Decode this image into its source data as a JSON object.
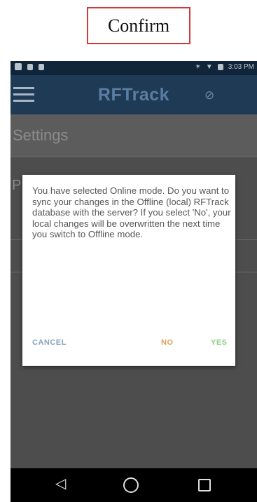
{
  "caption": "Confirm",
  "statusbar": {
    "time": "3:03 PM"
  },
  "toolbar": {
    "title": "RFTrack"
  },
  "settings": {
    "title": "Settings",
    "row_initial": "P"
  },
  "dialog": {
    "message": "You have selected Online mode. Do you want to sync your changes in the Offline (local) RFTrack database with the server? If you select 'No', your local changes will be overwritten the next time you switch to Offline mode.",
    "cancel_label": "CANCEL",
    "no_label": "NO",
    "yes_label": "YES"
  },
  "colors": {
    "toolbar": "#1e3a55",
    "no_button": "#e0a060",
    "yes_button": "#8fd08a",
    "cancel_button": "#8aa3b8",
    "caption_border": "#d23a3a"
  },
  "icons": [
    "image-icon",
    "notification-icon",
    "sd-card-icon",
    "bluetooth-icon",
    "wifi-icon",
    "battery-icon",
    "menu-icon",
    "sync-disabled-icon",
    "back-icon",
    "home-icon",
    "recents-icon"
  ]
}
